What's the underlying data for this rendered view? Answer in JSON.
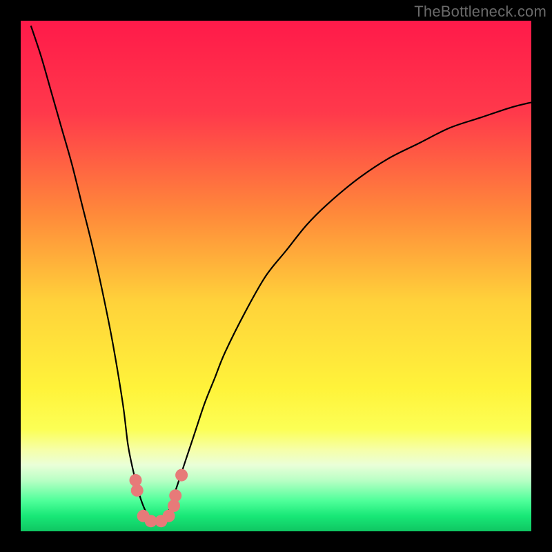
{
  "watermark": "TheBottleneck.com",
  "chart_data": {
    "type": "line",
    "title": "",
    "xlabel": "",
    "ylabel": "",
    "xlim": [
      0,
      100
    ],
    "ylim": [
      0,
      100
    ],
    "optimal_x": 26,
    "gradient_stops": [
      {
        "offset": 0.0,
        "color": "#ff1a4a"
      },
      {
        "offset": 0.18,
        "color": "#ff394b"
      },
      {
        "offset": 0.38,
        "color": "#ff8a3a"
      },
      {
        "offset": 0.55,
        "color": "#ffd23a"
      },
      {
        "offset": 0.72,
        "color": "#fff33a"
      },
      {
        "offset": 0.8,
        "color": "#fcff55"
      },
      {
        "offset": 0.84,
        "color": "#f6ffa8"
      },
      {
        "offset": 0.87,
        "color": "#eaffd8"
      },
      {
        "offset": 0.9,
        "color": "#b9ffc5"
      },
      {
        "offset": 0.94,
        "color": "#4fff9a"
      },
      {
        "offset": 0.97,
        "color": "#18e877"
      },
      {
        "offset": 1.0,
        "color": "#0fc662"
      }
    ],
    "series": [
      {
        "name": "left-curve",
        "x": [
          2,
          4,
          6,
          8,
          10,
          12,
          14,
          16,
          18,
          20,
          21,
          22,
          23,
          24,
          25,
          26
        ],
        "y": [
          99,
          93,
          86,
          79,
          72,
          64,
          56,
          47,
          37,
          25,
          17,
          12,
          8,
          5,
          3,
          2
        ]
      },
      {
        "name": "right-curve",
        "x": [
          28,
          29,
          30,
          31,
          32,
          34,
          36,
          38,
          40,
          44,
          48,
          52,
          56,
          60,
          66,
          72,
          78,
          84,
          90,
          96,
          100
        ],
        "y": [
          2,
          4,
          7,
          10,
          13,
          19,
          25,
          30,
          35,
          43,
          50,
          55,
          60,
          64,
          69,
          73,
          76,
          79,
          81,
          83,
          84
        ]
      }
    ],
    "marker_points": [
      {
        "x": 22.5,
        "y": 10
      },
      {
        "x": 22.8,
        "y": 8
      },
      {
        "x": 24.0,
        "y": 3
      },
      {
        "x": 25.5,
        "y": 2
      },
      {
        "x": 27.5,
        "y": 2
      },
      {
        "x": 29.0,
        "y": 3
      },
      {
        "x": 30.0,
        "y": 5
      },
      {
        "x": 30.3,
        "y": 7
      },
      {
        "x": 31.5,
        "y": 11
      }
    ],
    "marker_color": "#e77a79",
    "marker_radius": 9
  }
}
